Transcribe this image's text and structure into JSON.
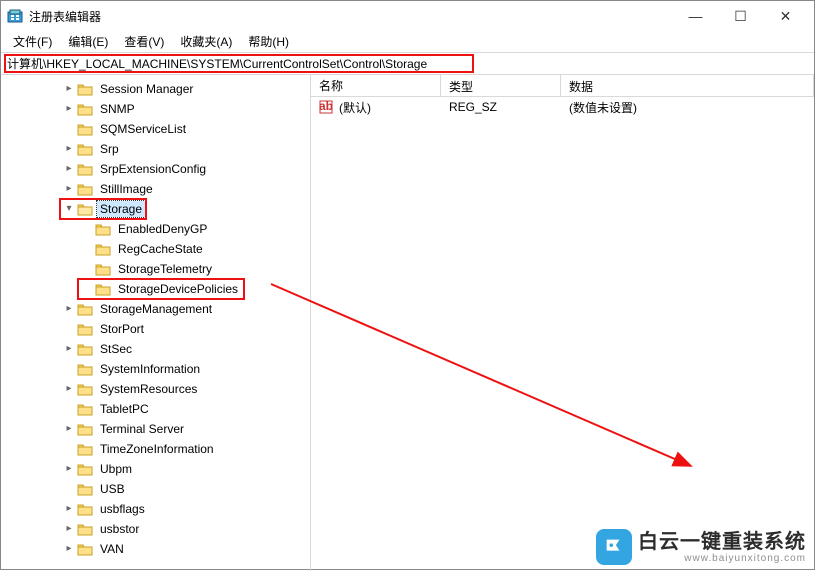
{
  "window": {
    "title": "注册表编辑器"
  },
  "menu": {
    "file": "文件(F)",
    "edit": "编辑(E)",
    "view": "查看(V)",
    "favorites": "收藏夹(A)",
    "help": "帮助(H)"
  },
  "address": {
    "path": "计算机\\HKEY_LOCAL_MACHINE\\SYSTEM\\CurrentControlSet\\Control\\Storage"
  },
  "tree": {
    "items": [
      {
        "label": "Session Manager",
        "indent": 0,
        "exp": ">"
      },
      {
        "label": "SNMP",
        "indent": 0,
        "exp": ">"
      },
      {
        "label": "SQMServiceList",
        "indent": 0,
        "exp": ""
      },
      {
        "label": "Srp",
        "indent": 0,
        "exp": ">"
      },
      {
        "label": "SrpExtensionConfig",
        "indent": 0,
        "exp": ">"
      },
      {
        "label": "StillImage",
        "indent": 0,
        "exp": ">"
      },
      {
        "label": "Storage",
        "indent": 0,
        "exp": "v",
        "selected": true,
        "highlight": "storage"
      },
      {
        "label": "EnabledDenyGP",
        "indent": 1,
        "exp": ""
      },
      {
        "label": "RegCacheState",
        "indent": 1,
        "exp": ""
      },
      {
        "label": "StorageTelemetry",
        "indent": 1,
        "exp": ""
      },
      {
        "label": "StorageDevicePolicies",
        "indent": 1,
        "exp": "",
        "highlight": "sdp"
      },
      {
        "label": "StorageManagement",
        "indent": 0,
        "exp": ">"
      },
      {
        "label": "StorPort",
        "indent": 0,
        "exp": ""
      },
      {
        "label": "StSec",
        "indent": 0,
        "exp": ">"
      },
      {
        "label": "SystemInformation",
        "indent": 0,
        "exp": ""
      },
      {
        "label": "SystemResources",
        "indent": 0,
        "exp": ">"
      },
      {
        "label": "TabletPC",
        "indent": 0,
        "exp": ""
      },
      {
        "label": "Terminal Server",
        "indent": 0,
        "exp": ">"
      },
      {
        "label": "TimeZoneInformation",
        "indent": 0,
        "exp": ""
      },
      {
        "label": "Ubpm",
        "indent": 0,
        "exp": ">"
      },
      {
        "label": "USB",
        "indent": 0,
        "exp": ""
      },
      {
        "label": "usbflags",
        "indent": 0,
        "exp": ">"
      },
      {
        "label": "usbstor",
        "indent": 0,
        "exp": ">"
      },
      {
        "label": "VAN",
        "indent": 0,
        "exp": ">"
      }
    ]
  },
  "list": {
    "cols": {
      "name": "名称",
      "type": "类型",
      "data": "数据"
    },
    "rows": [
      {
        "name": "(默认)",
        "type": "REG_SZ",
        "data": "(数值未设置)"
      }
    ]
  },
  "watermark": {
    "main": "白云一键重装系统",
    "sub": "www.baiyunxitong.com"
  }
}
